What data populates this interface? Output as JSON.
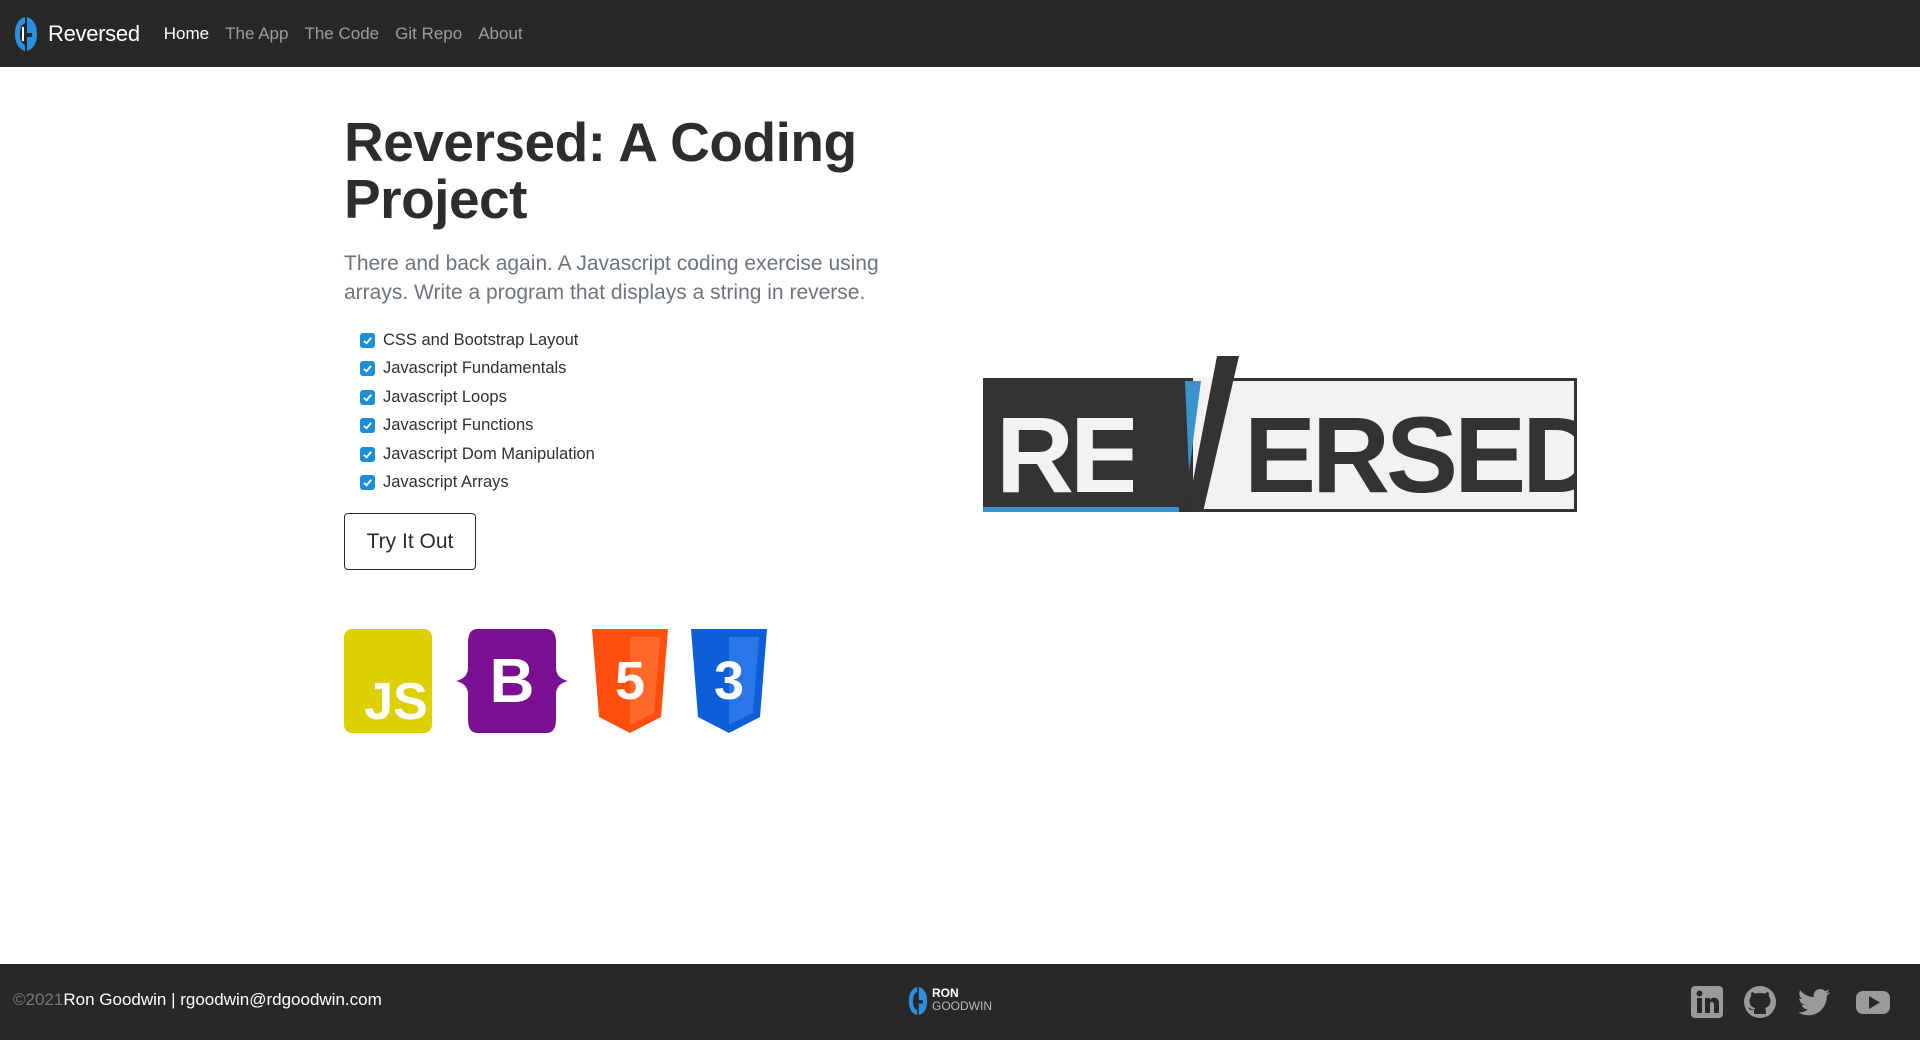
{
  "navbar": {
    "brand": "Reversed",
    "links": [
      {
        "label": "Home",
        "active": true
      },
      {
        "label": "The App",
        "active": false
      },
      {
        "label": "The Code",
        "active": false
      },
      {
        "label": "Git Repo",
        "active": false
      },
      {
        "label": "About",
        "active": false
      }
    ]
  },
  "hero": {
    "title_line1": "Reversed: A Coding",
    "title_line2": "Project",
    "lead": "There and back again. A Javascript coding exercise using arrays. Write a program that displays a string in reverse.",
    "skills": [
      "CSS and Bootstrap Layout",
      "Javascript Fundamentals",
      "Javascript Loops",
      "Javascript Functions",
      "Javascript Dom Manipulation",
      "Javascript Arrays"
    ],
    "button_label": "Try It Out"
  },
  "tech_icons": [
    {
      "name": "javascript-icon",
      "text": "JS",
      "color": "#dcd000"
    },
    {
      "name": "bootstrap-icon",
      "text": "B",
      "color": "#7a0f91"
    },
    {
      "name": "html5-icon",
      "text": "5",
      "color": "#ff4f0f"
    },
    {
      "name": "css3-icon",
      "text": "3",
      "color": "#0c5fd9"
    }
  ],
  "logo": {
    "text_left": "RE",
    "text_right": "ERSED",
    "accent_color": "#3b93cc",
    "dark_color": "#333333"
  },
  "footer": {
    "year": "©2021",
    "contact": "Ron Goodwin | rgoodwin@rdgoodwin.com",
    "logo_line1": "RON",
    "logo_line2": "GOODWIN",
    "social": [
      "linkedin-icon",
      "github-icon",
      "twitter-icon",
      "youtube-icon"
    ]
  },
  "colors": {
    "navbar_bg": "#282828",
    "checkbox": "#1a8fd6",
    "text_muted": "#6c757d"
  }
}
